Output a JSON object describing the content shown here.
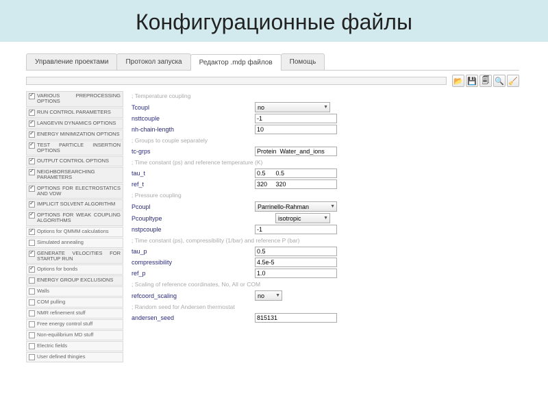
{
  "title": "Конфигурационные файлы",
  "tabs": [
    "Управление проектами",
    "Протокол запуска",
    "Редактор .mdp файлов",
    "Помощь"
  ],
  "active_tab": 2,
  "toolbar_icons": [
    "📂",
    "💾",
    "🗐",
    "🔍",
    "🧹"
  ],
  "sidebar": [
    {
      "label": "Various preprocessing options",
      "checked": true
    },
    {
      "label": "Run control parameters",
      "checked": true
    },
    {
      "label": "Langevin dynamics options",
      "checked": true
    },
    {
      "label": "Energy minimization options",
      "checked": true
    },
    {
      "label": "Test particle insertion options",
      "checked": true
    },
    {
      "label": "Output control options",
      "checked": true
    },
    {
      "label": "Neighborsearching parameters",
      "checked": true
    },
    {
      "label": "Options for electrostatics and VDW",
      "checked": true
    },
    {
      "label": "Implicit solvent algorithm",
      "checked": true
    },
    {
      "label": "Options for weak coupling algorithms",
      "checked": true
    },
    {
      "label": "Options for QMMM calculations",
      "checked": true,
      "minor": true
    },
    {
      "label": "Simulated annealing",
      "checked": false,
      "minor": true
    },
    {
      "label": "Generate velocities for startup run",
      "checked": true
    },
    {
      "label": "Options for bonds",
      "checked": true,
      "minor": true
    },
    {
      "label": "Energy group exclusions",
      "checked": false
    },
    {
      "label": "Walls",
      "checked": false,
      "minor": true
    },
    {
      "label": "COM pulling",
      "checked": false,
      "minor": true
    },
    {
      "label": "NMR refinement stuff",
      "checked": false,
      "minor": true
    },
    {
      "label": "Free energy control stuff",
      "checked": false,
      "minor": true
    },
    {
      "label": "Non-equilibrium MD stuff",
      "checked": false,
      "minor": true
    },
    {
      "label": "Electric fields",
      "checked": false,
      "minor": true
    },
    {
      "label": "User defined thingies",
      "checked": false,
      "minor": true
    }
  ],
  "form": {
    "c_temp": "; Temperature coupling",
    "tcoupl_l": "Tcoupl",
    "tcoupl_v": "no",
    "nsttcouple_l": "nsttcouple",
    "nsttcouple_v": "-1",
    "nhchain_l": "nh-chain-length",
    "nhchain_v": "10",
    "c_grp": "; Groups to couple separately",
    "tcgrps_l": "tc-grps",
    "tcgrps_v": "Protein  Water_and_ions",
    "c_tau": "; Time constant (ps) and reference temperature (K)",
    "taut_l": "tau_t",
    "taut_v": "0.5      0.5",
    "reft_l": "ref_t",
    "reft_v": "320     320",
    "c_press": "; Pressure coupling",
    "pcoupl_l": "Pcoupl",
    "pcoupl_v": "Parrinello-Rahman",
    "pcoupltype_l": "Pcoupltype",
    "pcoupltype_v": "isotropic",
    "nstpcouple_l": "nstpcouple",
    "nstpcouple_v": "-1",
    "c_taup": "; Time constant (ps), compressibility (1/bar) and reference P (bar)",
    "taup_l": "tau_p",
    "taup_v": "0.5",
    "compress_l": "compressibility",
    "compress_v": "4.5e-5",
    "refp_l": "ref_p",
    "refp_v": "1.0",
    "c_scale": "; Scaling of reference coordinates, No, All or COM",
    "refscale_l": "refcoord_scaling",
    "refscale_v": "no",
    "c_seed": "; Random seed for Andersen thermostat",
    "andseed_l": "andersen_seed",
    "andseed_v": "815131"
  }
}
